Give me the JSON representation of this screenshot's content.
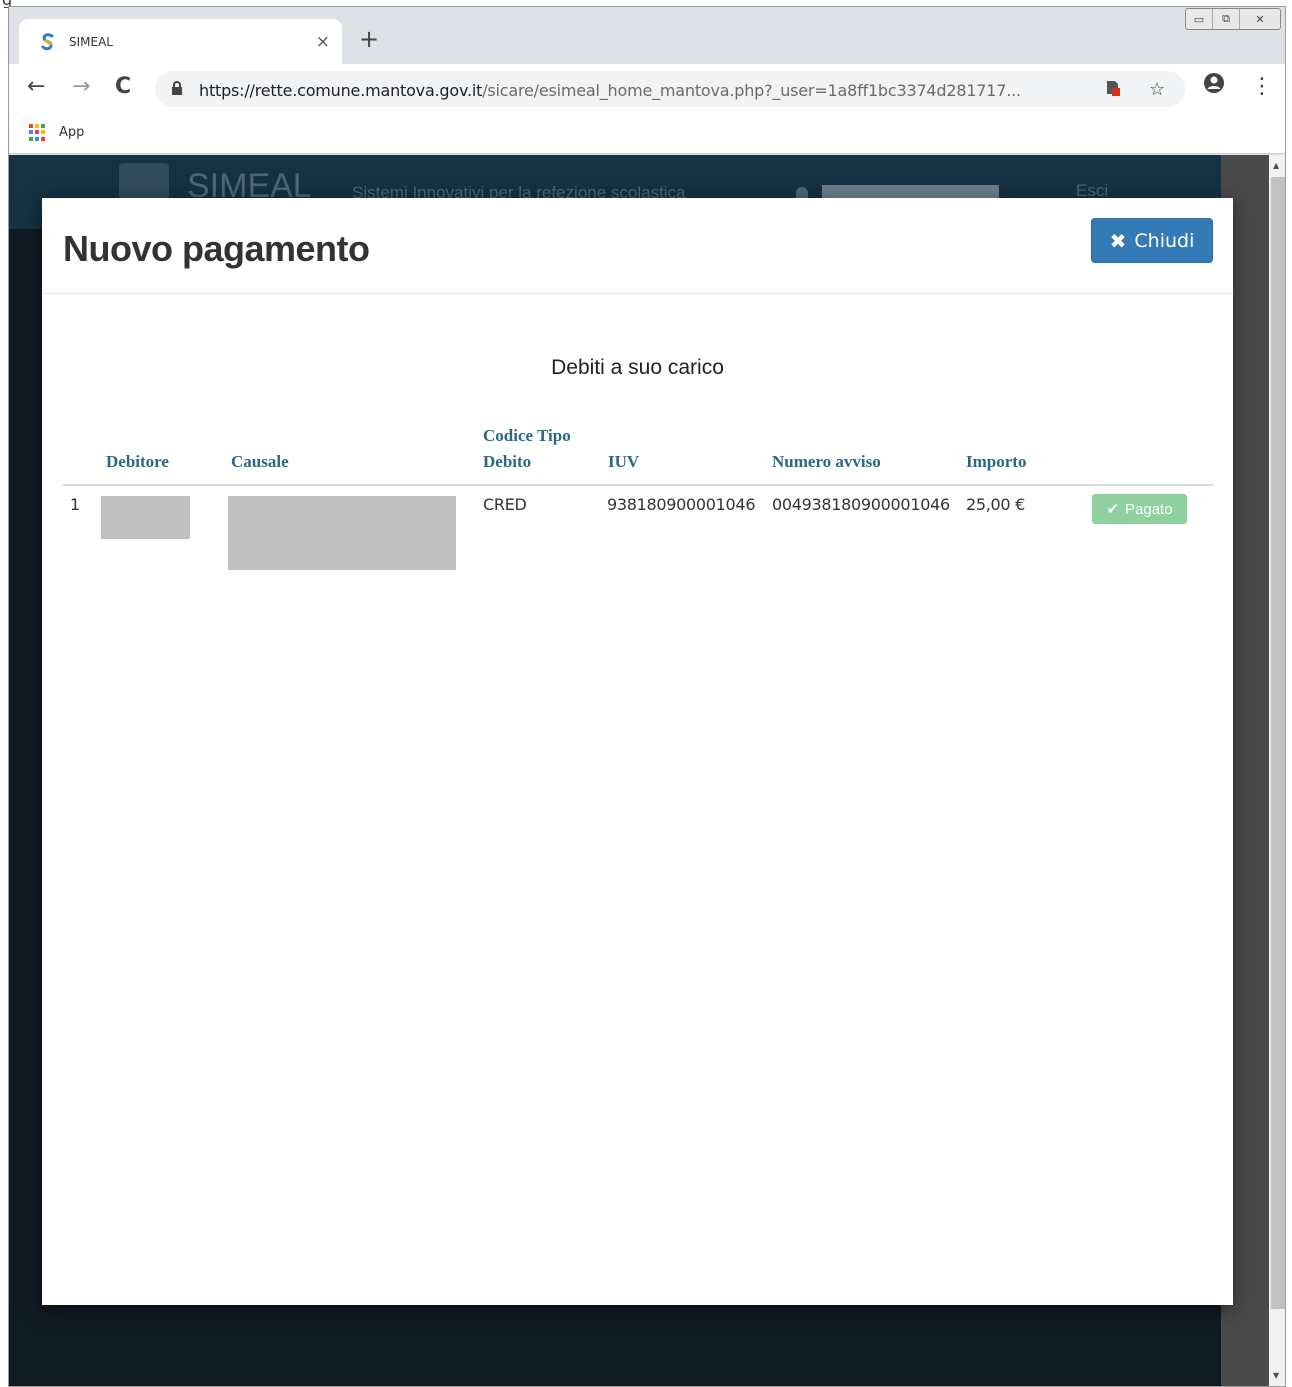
{
  "top_crop_text": "g",
  "browser": {
    "tab_title": "SIMEAL",
    "tab_close": "×",
    "new_tab": "+",
    "url_host": "https://rette.comune.mantova.gov.it",
    "url_path": "/sicare/esimeal_home_mantova.php?_user=1a8ff1bc3374d281717...",
    "bookmarks": {
      "apps_label": "App"
    },
    "window_controls": {
      "minimize": "▭",
      "restore": "⧉",
      "close": "✕"
    },
    "icons": {
      "back": "←",
      "forward": "→",
      "reload": "C",
      "star": "☆",
      "account": "●",
      "menu": "⋮"
    }
  },
  "site": {
    "name": "SIMEAL",
    "tagline": "Sistemi Innovativi per la refezione scolastica",
    "exit": "Esci"
  },
  "modal": {
    "title": "Nuovo pagamento",
    "close_label": "Chiudi",
    "close_icon_glyph": "✖",
    "section_title": "Debiti a suo carico",
    "columns": [
      "Debitore",
      "Causale",
      "Codice Tipo Debito",
      "IUV",
      "Numero avviso",
      "Importo"
    ],
    "column_lines": {
      "codice_line1": "Codice Tipo",
      "codice_line2": "Debito"
    },
    "rows": [
      {
        "index": "1",
        "codice_tipo_debito": "CRED",
        "iuv": "938180900001046",
        "numero_avviso": "004938180900001046",
        "importo": "25,00 €",
        "status": "Pagato",
        "status_icon_glyph": "✔"
      }
    ]
  },
  "colors": {
    "primary_button": "#337ab7",
    "paid_badge": "#8fd19e",
    "header_text": "#2b6983",
    "site_header": "#153144"
  }
}
